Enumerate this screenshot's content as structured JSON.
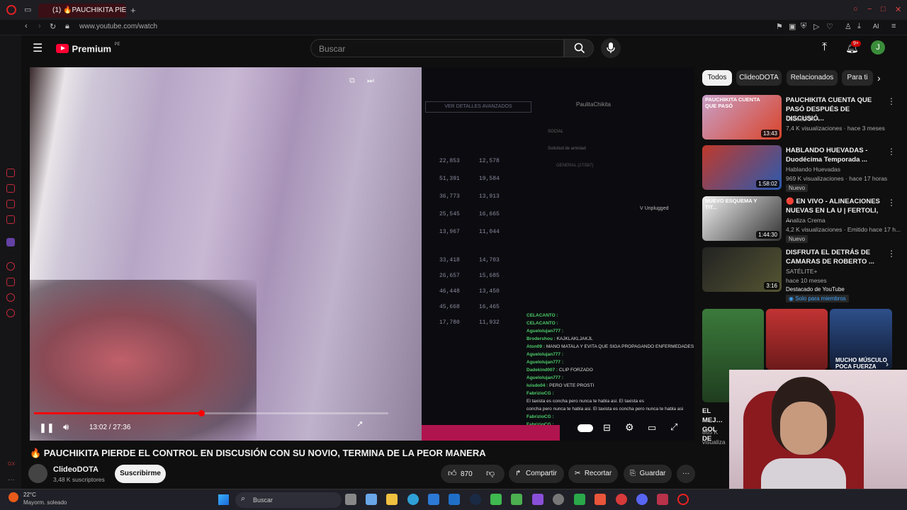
{
  "browser": {
    "tab_title": "(1) 🔥PAUCHIKITA PIE",
    "url": "www.youtube.com/watch",
    "ai_label": "AI"
  },
  "yt_header": {
    "logo": "Premium",
    "logo_region": "PE",
    "search_placeholder": "Buscar",
    "notif_count": "9+",
    "avatar_letter": "J"
  },
  "player": {
    "time": "13:02 / 27:36",
    "progress": 0.472,
    "overlay_button": "VER DETALLES AVANZADOS",
    "stream_name": "PaulitaChikita",
    "social_label": "SOCIAL",
    "friend_request": "Solicitud de amistad",
    "general_label": "GENERAL (27/587)",
    "unplugged": "V Unplugged",
    "stats": [
      [
        "22,853",
        "12,578"
      ],
      [
        "51,391",
        "19,584"
      ],
      [
        "36,773",
        "13,913"
      ],
      [
        "25,545",
        "16,665"
      ],
      [
        "13,967",
        "11,044"
      ],
      [
        "33,418",
        "14,703"
      ],
      [
        "26,657",
        "15,685"
      ],
      [
        "46,448",
        "13,450"
      ],
      [
        "45,668",
        "16,465"
      ],
      [
        "17,780",
        "11,932"
      ]
    ],
    "chat": [
      {
        "user": "CELACANTO",
        "msg": ""
      },
      {
        "user": "CELACANTO",
        "msg": ""
      },
      {
        "user": "Aguelolujan777",
        "msg": ""
      },
      {
        "user": "Brodershou",
        "msg": "KAJKLAKLJAKJL"
      },
      {
        "user": "Aton09",
        "msg": "MANO MATALA Y EVITA QUE SIGA PROPAGANDO ENFERMEDADES"
      },
      {
        "user": "Aguelolujan777",
        "msg": ""
      },
      {
        "user": "Aguelolujan777",
        "msg": ""
      },
      {
        "user": "Dadekind007",
        "msg": "CLIP FORZADO"
      },
      {
        "user": "Aguelolujan777",
        "msg": ""
      },
      {
        "user": "luisdo04",
        "msg": "PERO VETE PROSTI"
      },
      {
        "user": "FabrizioCG",
        "msg": ""
      },
      {
        "user": "",
        "msg": "El taxista es concha pero nunca te habla asi. El taxista es"
      },
      {
        "user": "",
        "msg": "concha pero nunca te habla asi. El taxista es concha pero nunca te habla asi"
      },
      {
        "user": "FabrizioCG",
        "msg": ""
      },
      {
        "user": "FabrizioCG",
        "msg": ""
      }
    ]
  },
  "video_info": {
    "title": "🔥 PAUCHIKITA PIERDE EL CONTROL EN DISCUSIÓN CON SU NOVIO, TERMINA DE LA PEOR MANERA",
    "channel": "ClideoDOTA",
    "subscribers": "3,48 K suscriptores",
    "subscribe_label": "Suscribirme",
    "likes": "870",
    "share_label": "Compartir",
    "clip_label": "Recortar",
    "save_label": "Guardar"
  },
  "chips": [
    "Todos",
    "ClideoDOTA",
    "Relacionados",
    "Para ti"
  ],
  "recommendations": [
    {
      "title": "PAUCHIKITA CUENTA QUE PASÓ DESPUÉS DE DISCUSIÓ...",
      "channel": "ClideoDOTA",
      "meta": "7,4 K visualizaciones · hace 3 meses",
      "duration": "13:43",
      "thumb_text": "PAUCHIKITA CUENTA QUE PASÓ",
      "badge": ""
    },
    {
      "title": "HABLANDO HUEVADAS - Duodécima Temporada ...",
      "channel": "Hablando Huevadas",
      "meta": "969 K visualizaciones · hace 17 horas",
      "duration": "1:58:02",
      "thumb_text": "",
      "badge": "Nuevo"
    },
    {
      "title": "🔴 EN VIVO - ALINEACIONES NUEVAS EN LA U | FERTOLI, ...",
      "channel": "Analiza Crema",
      "meta": "4,2 K visualizaciones · Emitido hace 17 h...",
      "duration": "1:44:30",
      "thumb_text": "NUEVO ESQUEMA Y TIT...",
      "badge": "Nuevo"
    },
    {
      "title": "DISFRUTA EL DETRÁS DE CAMARAS DE ROBERTO ...",
      "channel": "SATÉLITE+",
      "meta": "hace 10 meses",
      "duration": "3:16",
      "thumb_text": "",
      "badge": "Destacado de YouTube",
      "members": "Solo para miembros"
    }
  ],
  "shelf": {
    "title_partial": "EL MEJ… GOL DE",
    "views_partial": "865 K",
    "meta_partial": "visualiza",
    "thumb_text": "MUCHO MÚSCULO POCA FUERZA"
  },
  "taskbar": {
    "temp": "22°C",
    "weather": "Mayorm. soleado",
    "search": "Buscar"
  },
  "colors": {
    "accent": "#ff0000",
    "brand": "#ff0033",
    "subscribe_bg": "#f1f1f1",
    "bg": "#0f0f0f"
  }
}
